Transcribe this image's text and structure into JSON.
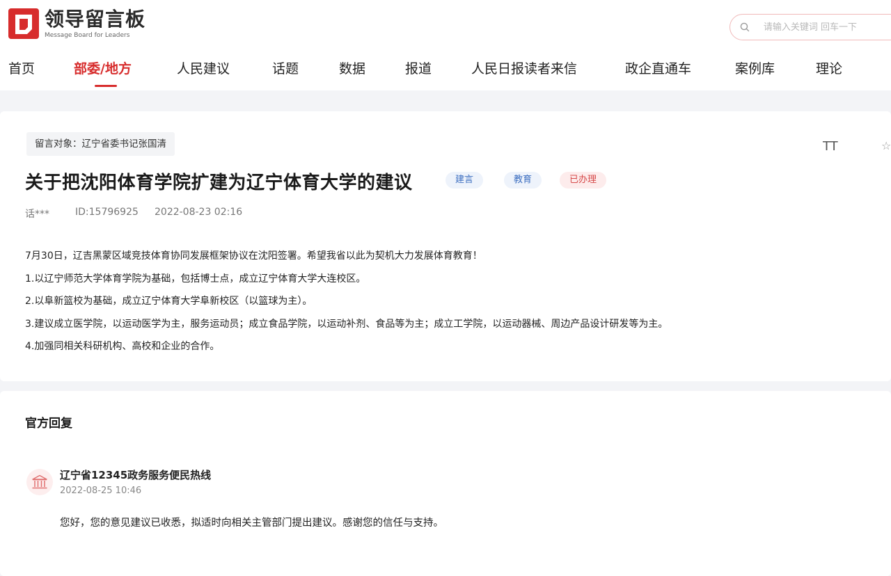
{
  "header": {
    "logo_title": "领导留言板",
    "logo_subtitle": "Message Board for Leaders",
    "search_placeholder": "请输入关键词 回车一下"
  },
  "nav": [
    {
      "label": "首页",
      "active": false
    },
    {
      "label": "部委/地方",
      "active": true
    },
    {
      "label": "人民建议",
      "active": false
    },
    {
      "label": "话题",
      "active": false
    },
    {
      "label": "数据",
      "active": false
    },
    {
      "label": "报道",
      "active": false
    },
    {
      "label": "人民日报读者来信",
      "active": false
    },
    {
      "label": "政企直通车",
      "active": false
    },
    {
      "label": "案例库",
      "active": false
    },
    {
      "label": "理论",
      "active": false
    }
  ],
  "message": {
    "target": "留言对象：辽宁省委书记张国清",
    "font_size_label": "TT",
    "title": "关于把沈阳体育学院扩建为辽宁体育大学的建议",
    "tags": [
      {
        "label": "建言",
        "tone": "blue"
      },
      {
        "label": "教育",
        "tone": "blue"
      },
      {
        "label": "已办理",
        "tone": "red"
      }
    ],
    "author": "话***",
    "id": "ID:15796925",
    "datetime": "2022-08-23 02:16",
    "body": [
      "7月30日，辽吉黑蒙区域竞技体育协同发展框架协议在沈阳签署。希望我省以此为契机大力发展体育教育！",
      "1.以辽宁师范大学体育学院为基础，包括博士点，成立辽宁体育大学大连校区。",
      "2.以阜新篮校为基础，成立辽宁体育大学阜新校区（以篮球为主）。",
      "3.建议成立医学院，以运动医学为主，服务运动员；成立食品学院，以运动补剂、食品等为主；成立工学院，以运动器械、周边产品设计研发等为主。",
      "4.加强同相关科研机构、高校和企业的合作。"
    ]
  },
  "reply": {
    "heading": "官方回复",
    "org": "辽宁省12345政务服务便民热线",
    "datetime": "2022-08-25 10:46",
    "content": "您好，您的意见建议已收悉，拟适时向相关主管部门提出建议。感谢您的信任与支持。"
  },
  "colors": {
    "accent": "#d72c2c",
    "tag_blue": "#3d6fc0",
    "tag_red": "#d64a4a"
  },
  "icons": {
    "logo": "logo-mark-icon",
    "search": "search-icon",
    "font_size": "font-size-icon",
    "favorite": "star-icon",
    "reply_avatar": "government-building-icon"
  }
}
